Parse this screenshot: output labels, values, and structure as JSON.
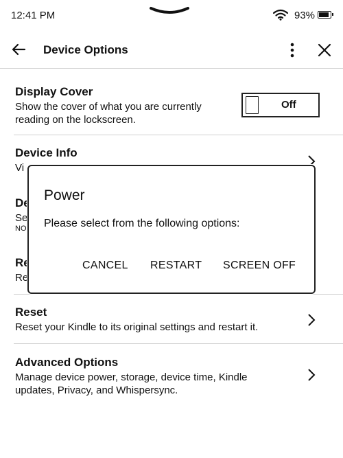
{
  "status_bar": {
    "time": "12:41 PM",
    "battery_percent": "93%",
    "battery_level": 0.93,
    "icons": [
      "wifi-icon",
      "battery-icon"
    ]
  },
  "header": {
    "title": "Device Options",
    "icons": [
      "back-arrow-icon",
      "more-vertical-icon",
      "close-icon"
    ]
  },
  "settings": {
    "display_cover": {
      "title": "Display Cover",
      "description_line1": "Show the cover of what you are currently",
      "description_line2": "reading on the lockscreen.",
      "toggle_label": "Off",
      "toggle_on": false
    },
    "device_info": {
      "title": "Device Info",
      "description_fragment": "Vi"
    },
    "partial_row_a": {
      "title_fragment": "De",
      "desc_fragment": "Se",
      "small_fragment": "NO"
    },
    "partial_row_b": {
      "title_fragment": "Re",
      "desc_fragment": "Re"
    },
    "reset": {
      "title": "Reset",
      "description": "Reset your Kindle to its original settings and restart it."
    },
    "advanced": {
      "title": "Advanced Options",
      "description_line1": "Manage device power, storage, device time, Kindle",
      "description_line2": "updates, Privacy, and Whispersync."
    }
  },
  "dialog": {
    "title": "Power",
    "message": "Please select from the following options:",
    "buttons": {
      "cancel": "CANCEL",
      "restart": "RESTART",
      "screen_off": "SCREEN OFF"
    }
  },
  "colors": {
    "text": "#111111",
    "divider": "#cfcfcf",
    "background": "#ffffff"
  }
}
